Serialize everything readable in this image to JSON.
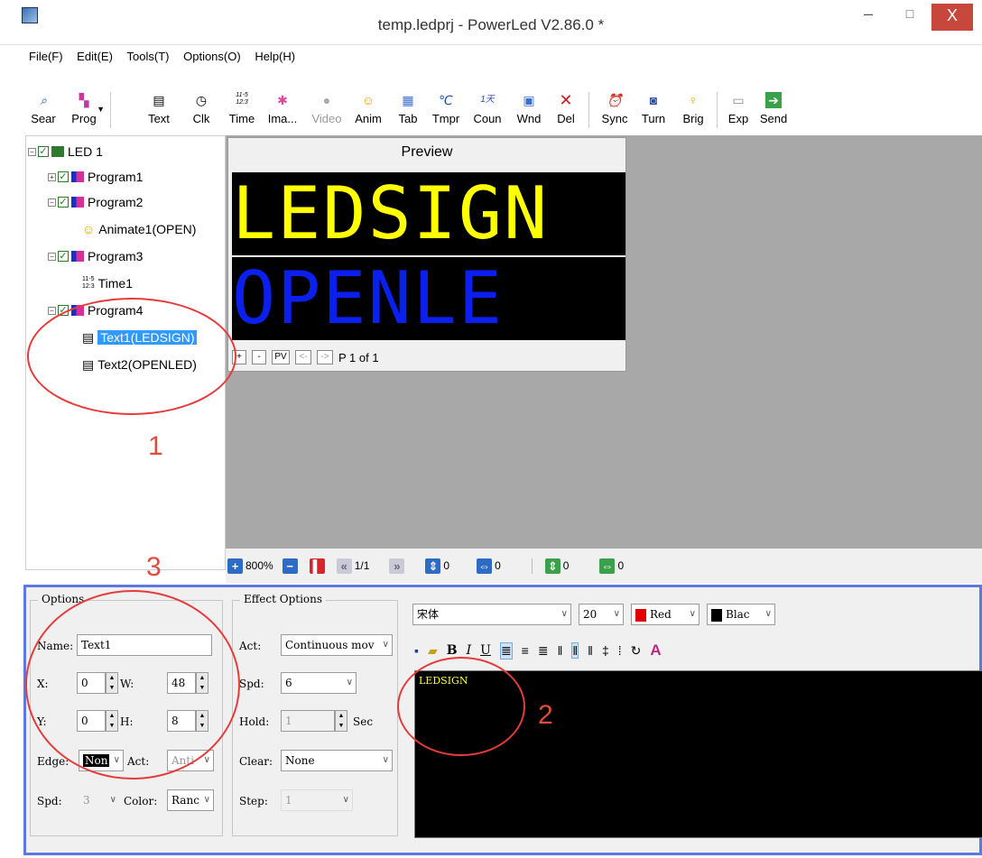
{
  "window": {
    "title": "temp.ledprj - PowerLed V2.86.0 *",
    "minimize": "–",
    "maximize": "□",
    "close": "X"
  },
  "menu": [
    "File(F)",
    "Edit(E)",
    "Tools(T)",
    "Options(O)",
    "Help(H)"
  ],
  "toolbar": [
    {
      "label": "Sear",
      "icon": "search-icon"
    },
    {
      "label": "Prog",
      "icon": "program-icon"
    },
    {
      "label": "Text",
      "icon": "text-icon"
    },
    {
      "label": "Clk",
      "icon": "clock-icon"
    },
    {
      "label": "Time",
      "icon": "time-icon"
    },
    {
      "label": "Ima...",
      "icon": "image-icon"
    },
    {
      "label": "Video",
      "icon": "video-icon",
      "disabled": true
    },
    {
      "label": "Anim",
      "icon": "smiley-icon"
    },
    {
      "label": "Tab",
      "icon": "table-icon"
    },
    {
      "label": "Tmpr",
      "icon": "temperature-icon"
    },
    {
      "label": "Coun",
      "icon": "counter-icon"
    },
    {
      "label": "Wnd",
      "icon": "window-icon"
    },
    {
      "label": "Del",
      "icon": "delete-icon"
    },
    {
      "label": "Sync",
      "icon": "sync-icon"
    },
    {
      "label": "Turn",
      "icon": "turn-icon"
    },
    {
      "label": "Brig",
      "icon": "brightness-icon"
    },
    {
      "label": "Exp",
      "icon": "export-icon"
    },
    {
      "label": "Send",
      "icon": "send-icon"
    }
  ],
  "toolbar_icon_text": {
    "time": "11-5\n12:3",
    "tmpr": "℃",
    "coun": "1天"
  },
  "tree": {
    "led": "LED 1",
    "program1": "Program1",
    "program2": "Program2",
    "animate1": "Animate1(OPEN)",
    "program3": "Program3",
    "time1": "Time1",
    "program4": "Program4",
    "text1": "Text1(LEDSIGN)",
    "text2": "Text2(OPENLED)"
  },
  "preview": {
    "title": "Preview",
    "line1": "LEDSIGN",
    "line2": "OPENLE",
    "line1_color": "#ffff00",
    "line2_color": "#0b20ee",
    "page_text": "P 1 of 1",
    "buttons": [
      "+",
      "-",
      "PV",
      "<-",
      "->"
    ]
  },
  "status": {
    "zoom": "800%",
    "page": "1/1",
    "v1": "0",
    "v2": "0",
    "v3": "0",
    "v4": "0"
  },
  "options": {
    "title": "Options",
    "name_label": "Name:",
    "name_value": "Text1",
    "x_label": "X:",
    "x_value": "0",
    "w_label": "W:",
    "w_value": "48",
    "y_label": "Y:",
    "y_value": "0",
    "h_label": "H:",
    "h_value": "8",
    "edge_label": "Edge:",
    "edge_value": "Non",
    "act_label": "Act:",
    "act_value": "Anti",
    "spd_label": "Spd:",
    "spd_value": "3",
    "color_label": "Color:",
    "color_value": "Ranc"
  },
  "effect": {
    "title": "Effect Options",
    "act_label": "Act:",
    "act_value": "Continuous mov",
    "spd_label": "Spd:",
    "spd_value": "6",
    "hold_label": "Hold:",
    "hold_value": "1",
    "hold_unit": "Sec",
    "clear_label": "Clear:",
    "clear_value": "None",
    "step_label": "Step:",
    "step_value": "1"
  },
  "format": {
    "font": "宋体",
    "size": "20",
    "fg": "Red",
    "bg": "Blac"
  },
  "editor": {
    "text": "LEDSIGN"
  },
  "annotations": [
    "1",
    "2",
    "3"
  ]
}
